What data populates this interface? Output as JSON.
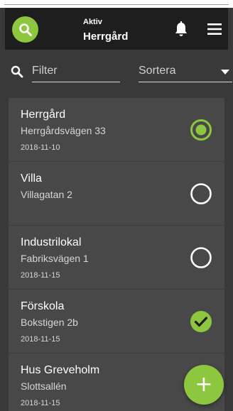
{
  "colors": {
    "accent": "#8dc63f",
    "appbar": "#1e1e1e",
    "background": "#393939",
    "card": "#484848",
    "text": "#ffffff",
    "muted": "#d6d6d6"
  },
  "header": {
    "search_icon": "search-icon",
    "subtitle": "Aktiv",
    "title": "Herrgård",
    "notification_icon": "bell-icon",
    "menu_icon": "hamburger-menu-icon"
  },
  "filter": {
    "search_icon": "search-icon",
    "placeholder": "Filter",
    "value": "",
    "sort_label": "Sortera",
    "sort_icon": "caret-down-icon"
  },
  "items": [
    {
      "name": "Herrgård",
      "address": "Herrgårdsvägen 33",
      "date": "2018-11-10",
      "status": "selected",
      "status_icon": "radio-selected-icon"
    },
    {
      "name": "Villa",
      "address": "Villagatan 2",
      "date": "",
      "status": "unselected",
      "status_icon": "radio-empty-icon"
    },
    {
      "name": "Industrilokal",
      "address": "Fabriksvägen 1",
      "date": "2018-11-15",
      "status": "unselected",
      "status_icon": "radio-empty-icon"
    },
    {
      "name": "Förskola",
      "address": "Bokstigen 2b",
      "date": "2018-11-15",
      "status": "done",
      "status_icon": "check-circle-icon"
    },
    {
      "name": "Hus Greveholm",
      "address": "Slottsallén",
      "date": "2018-11-15",
      "status": "none",
      "status_icon": ""
    }
  ],
  "fab": {
    "icon": "plus-icon",
    "label": "+"
  }
}
